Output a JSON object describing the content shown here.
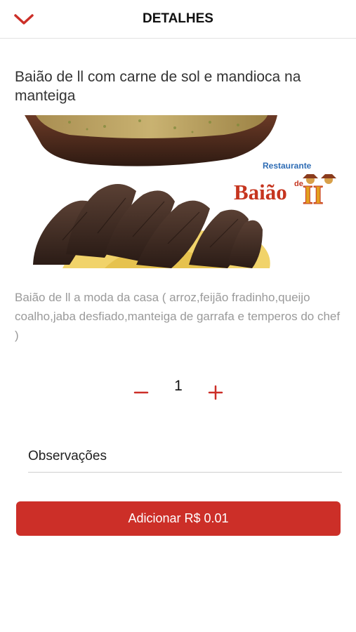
{
  "header": {
    "title": "DETALHES",
    "back_icon": "chevron-down-icon"
  },
  "product": {
    "title": "Baião de ll com carne de sol e mandioca na manteiga",
    "description": "Baião de ll a moda da casa ( arroz,feijão fradinho,queijo coalho,jaba desfiado,manteiga de garrafa e temperos do chef )",
    "image_logo_text": "Restaurante Baião de ll"
  },
  "quantity": {
    "value": "1",
    "minus_icon": "minus-icon",
    "plus_icon": "plus-icon"
  },
  "observations": {
    "placeholder": "Observações",
    "value": ""
  },
  "add_button": {
    "label": "Adicionar R$ 0.01"
  },
  "colors": {
    "accent": "#cc2f28",
    "description_text": "#9a9a9a"
  }
}
